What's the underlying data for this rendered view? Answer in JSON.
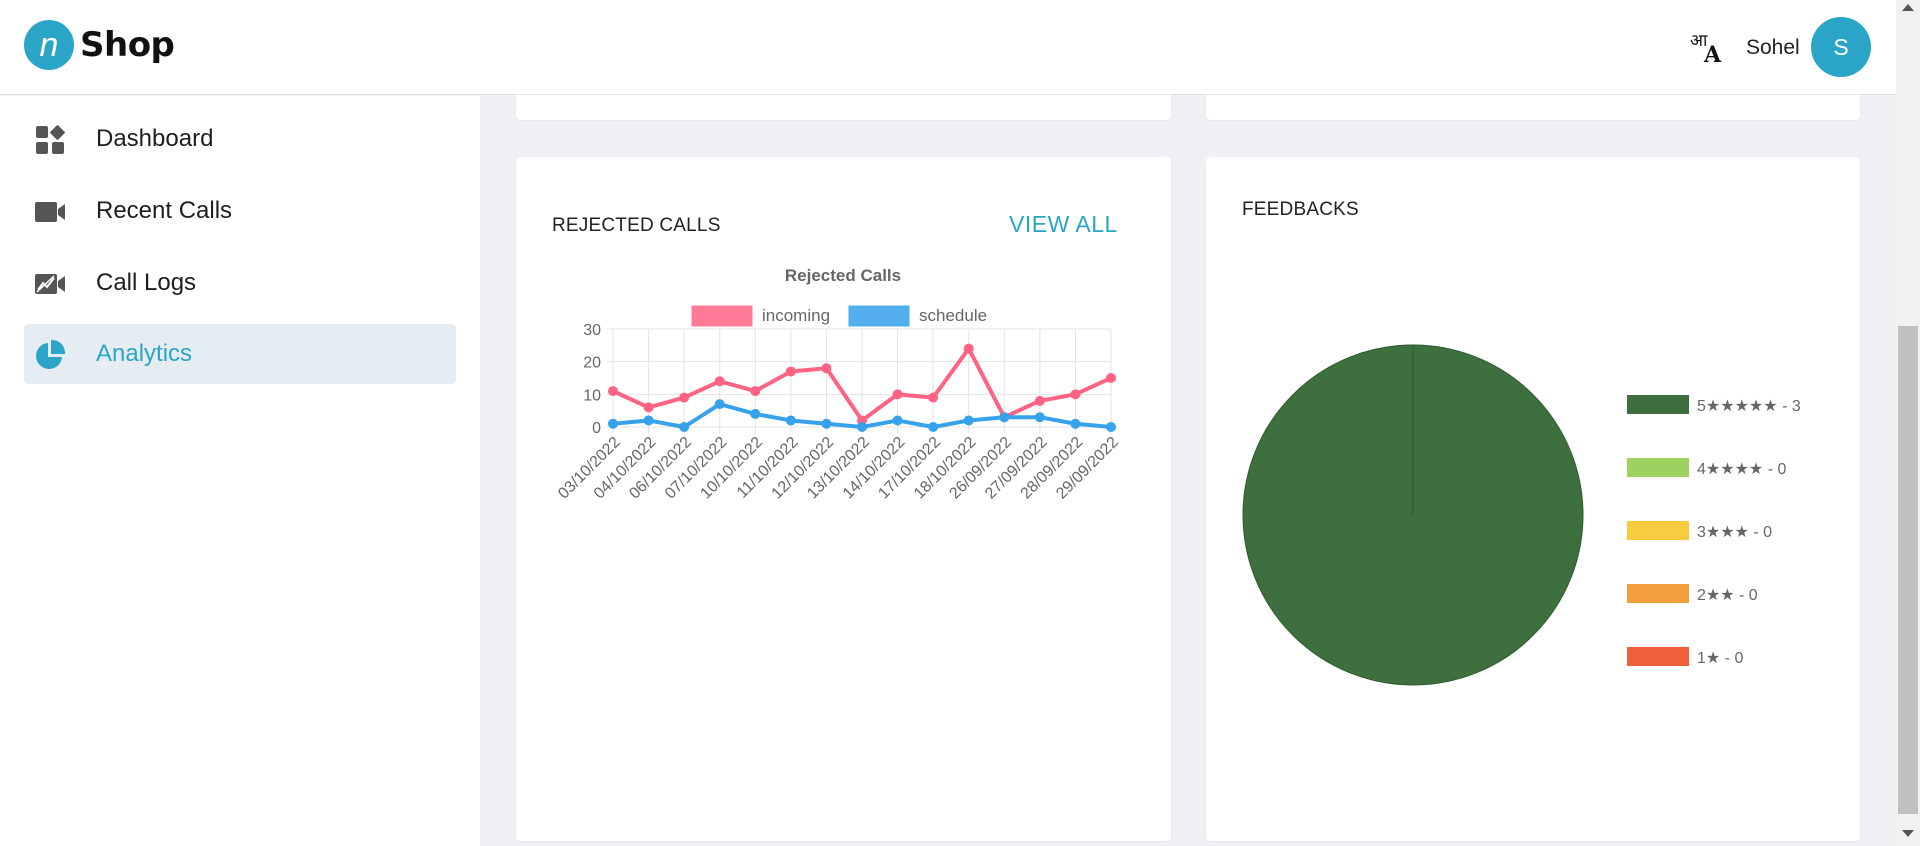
{
  "header": {
    "logo_letter": "n",
    "logo_text": "Shop",
    "lang_icon_top": "आ",
    "lang_icon_bottom": "A",
    "username": "Sohel",
    "avatar_initial": "S"
  },
  "sidebar": {
    "items": [
      {
        "label": "Dashboard",
        "icon": "dashboard-icon",
        "active": false
      },
      {
        "label": "Recent Calls",
        "icon": "video-camera-icon",
        "active": false
      },
      {
        "label": "Call Logs",
        "icon": "call-log-icon",
        "active": false
      },
      {
        "label": "Analytics",
        "icon": "pie-chart-icon",
        "active": true
      }
    ]
  },
  "rejected_card": {
    "title": "REJECTED CALLS",
    "view_all": "VIEW ALL"
  },
  "feedback_card": {
    "title": "FEEDBACKS"
  },
  "colors": {
    "accent": "#2aa5c8",
    "incoming": "#ff6384",
    "schedule": "#36a2eb"
  },
  "chart_data": [
    {
      "type": "line",
      "title": "Rejected Calls",
      "categories": [
        "03/10/2022",
        "04/10/2022",
        "06/10/2022",
        "07/10/2022",
        "10/10/2022",
        "11/10/2022",
        "12/10/2022",
        "13/10/2022",
        "14/10/2022",
        "17/10/2022",
        "18/10/2022",
        "26/09/2022",
        "27/09/2022",
        "28/09/2022",
        "29/09/2022"
      ],
      "series": [
        {
          "name": "incoming",
          "color": "#ff6384",
          "values": [
            11,
            6,
            9,
            14,
            11,
            17,
            18,
            2,
            10,
            9,
            24,
            3,
            8,
            10,
            15
          ]
        },
        {
          "name": "schedule",
          "color": "#36a2eb",
          "values": [
            1,
            2,
            0,
            7,
            4,
            2,
            1,
            0,
            2,
            0,
            2,
            3,
            3,
            1,
            0
          ]
        }
      ],
      "ylim": [
        0,
        30
      ],
      "yticks": [
        0,
        10,
        20,
        30
      ],
      "grid": true,
      "legend": "top"
    },
    {
      "type": "pie",
      "categories": [
        "5★★★★★ - 3",
        "4★★★★ - 0",
        "3★★★ - 0",
        "2★★ - 0",
        "1★ - 0"
      ],
      "values": [
        3,
        0,
        0,
        0,
        0
      ],
      "colors": [
        "#3e6f3e",
        "#9ed260",
        "#f7cd3f",
        "#f29f3f",
        "#f05f3b"
      ],
      "legend": "right"
    }
  ]
}
